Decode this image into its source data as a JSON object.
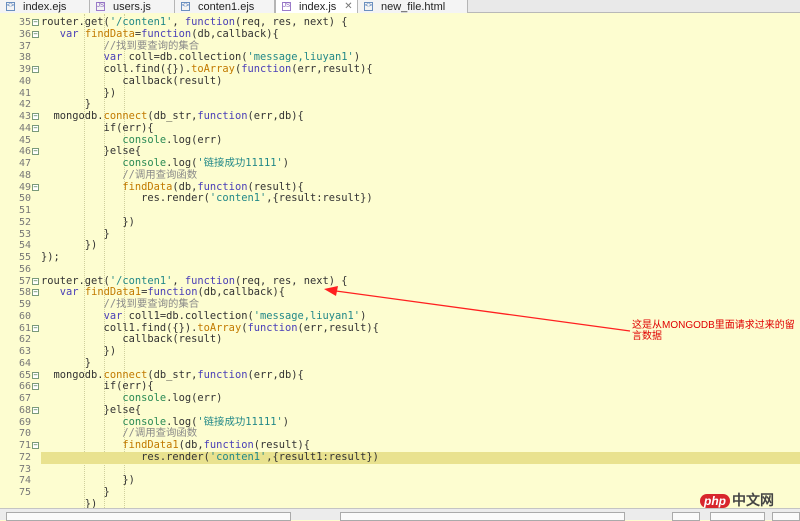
{
  "tabs": [
    {
      "label": "index.ejs",
      "type": "ejs"
    },
    {
      "label": "users.js",
      "type": "js"
    },
    {
      "label": "conten1.ejs",
      "type": "ejs"
    },
    {
      "label": "index.js",
      "type": "js",
      "active": true
    },
    {
      "label": "new_file.html",
      "type": "html"
    }
  ],
  "tab_icon_text": {
    "ejs": "<>",
    "html": "<>",
    "js": "JS"
  },
  "close_glyph": "✕",
  "highlighted_line": "72",
  "lines": [
    {
      "n": "35",
      "fold": true,
      "seg": [
        [
          "router.get(",
          ""
        ],
        [
          "'/conten1'",
          "str"
        ],
        [
          ", ",
          ""
        ],
        [
          "function",
          "kw"
        ],
        [
          "(req, res, next) {",
          ""
        ]
      ]
    },
    {
      "n": "36",
      "fold": true,
      "seg": [
        [
          "   ",
          ""
        ],
        [
          "var",
          "kw"
        ],
        [
          " ",
          ""
        ],
        [
          "findData",
          "fn"
        ],
        [
          "=",
          ""
        ],
        [
          "function",
          "kw"
        ],
        [
          "(db,callback){",
          ""
        ]
      ]
    },
    {
      "n": "37",
      "seg": [
        [
          "          ",
          ""
        ],
        [
          "//找到要查询的集合",
          "cm"
        ]
      ]
    },
    {
      "n": "38",
      "seg": [
        [
          "          ",
          ""
        ],
        [
          "var",
          "kw"
        ],
        [
          " coll=db.collection(",
          ""
        ],
        [
          "'message,liuyan1'",
          "str"
        ],
        [
          ")",
          ""
        ]
      ]
    },
    {
      "n": "39",
      "fold": true,
      "seg": [
        [
          "          coll.find({}).",
          ""
        ],
        [
          "toArray",
          "fn"
        ],
        [
          "(",
          ""
        ],
        [
          "function",
          "kw"
        ],
        [
          "(err,result){",
          ""
        ]
      ]
    },
    {
      "n": "40",
      "seg": [
        [
          "             callback(result)",
          ""
        ]
      ]
    },
    {
      "n": "41",
      "seg": [
        [
          "          })",
          ""
        ]
      ]
    },
    {
      "n": "42",
      "seg": [
        [
          "       }",
          ""
        ]
      ]
    },
    {
      "n": "43",
      "fold": true,
      "seg": [
        [
          "  mongodb.",
          ""
        ],
        [
          "connect",
          "fn"
        ],
        [
          "(db_str,",
          ""
        ],
        [
          "function",
          "kw"
        ],
        [
          "(err,db){",
          ""
        ]
      ]
    },
    {
      "n": "44",
      "fold": true,
      "seg": [
        [
          "          if(err){",
          ""
        ]
      ]
    },
    {
      "n": "45",
      "seg": [
        [
          "             ",
          ""
        ],
        [
          "console",
          "con"
        ],
        [
          ".log(err)",
          ""
        ]
      ]
    },
    {
      "n": "46",
      "fold": true,
      "seg": [
        [
          "          }else{",
          ""
        ]
      ]
    },
    {
      "n": "47",
      "seg": [
        [
          "             ",
          ""
        ],
        [
          "console",
          "con"
        ],
        [
          ".log(",
          ""
        ],
        [
          "'链接成功11111'",
          "str"
        ],
        [
          ")",
          ""
        ]
      ]
    },
    {
      "n": "48",
      "seg": [
        [
          "             ",
          ""
        ],
        [
          "//调用查询函数",
          "cm"
        ]
      ]
    },
    {
      "n": "49",
      "fold": true,
      "seg": [
        [
          "             ",
          ""
        ],
        [
          "findData",
          "fn"
        ],
        [
          "(db,",
          ""
        ],
        [
          "function",
          "kw"
        ],
        [
          "(result){",
          ""
        ]
      ]
    },
    {
      "n": "50",
      "seg": [
        [
          "                ",
          ""
        ],
        [
          "res.render(",
          ""
        ],
        [
          "'conten1'",
          "str"
        ],
        [
          ",{result:result})",
          ""
        ]
      ]
    },
    {
      "n": "51",
      "seg": []
    },
    {
      "n": "52",
      "seg": [
        [
          "             })",
          ""
        ]
      ]
    },
    {
      "n": "53",
      "seg": [
        [
          "          }",
          ""
        ]
      ]
    },
    {
      "n": "54",
      "seg": [
        [
          "       })",
          ""
        ]
      ]
    },
    {
      "n": "55",
      "seg": [
        [
          "});",
          ""
        ]
      ]
    },
    {
      "n": "56",
      "seg": []
    },
    {
      "n": "57",
      "fold": true,
      "seg": [
        [
          "router.get(",
          ""
        ],
        [
          "'/conten1'",
          "str"
        ],
        [
          ", ",
          ""
        ],
        [
          "function",
          "kw"
        ],
        [
          "(req, res, next) {",
          ""
        ]
      ]
    },
    {
      "n": "58",
      "fold": true,
      "seg": [
        [
          "   ",
          ""
        ],
        [
          "var",
          "kw"
        ],
        [
          " ",
          ""
        ],
        [
          "findData1",
          "fn"
        ],
        [
          "=",
          ""
        ],
        [
          "function",
          "kw"
        ],
        [
          "(db,callback){",
          ""
        ]
      ]
    },
    {
      "n": "59",
      "seg": [
        [
          "          ",
          ""
        ],
        [
          "//找到要查询的集合",
          "cm"
        ]
      ]
    },
    {
      "n": "60",
      "seg": [
        [
          "          ",
          ""
        ],
        [
          "var",
          "kw"
        ],
        [
          " coll1=db.collection(",
          ""
        ],
        [
          "'message,liuyan1'",
          "str"
        ],
        [
          ")",
          ""
        ]
      ]
    },
    {
      "n": "61",
      "fold": true,
      "seg": [
        [
          "          coll1.find({}).",
          ""
        ],
        [
          "toArray",
          "fn"
        ],
        [
          "(",
          ""
        ],
        [
          "function",
          "kw"
        ],
        [
          "(err,result){",
          ""
        ]
      ]
    },
    {
      "n": "62",
      "seg": [
        [
          "             callback(result)",
          ""
        ]
      ]
    },
    {
      "n": "63",
      "seg": [
        [
          "          })",
          ""
        ]
      ]
    },
    {
      "n": "64",
      "seg": [
        [
          "       }",
          ""
        ]
      ]
    },
    {
      "n": "65",
      "fold": true,
      "seg": [
        [
          "  mongodb.",
          ""
        ],
        [
          "connect",
          "fn"
        ],
        [
          "(db_str,",
          ""
        ],
        [
          "function",
          "kw"
        ],
        [
          "(err,db){",
          ""
        ]
      ]
    },
    {
      "n": "66",
      "fold": true,
      "seg": [
        [
          "          if(err){",
          ""
        ]
      ]
    },
    {
      "n": "67",
      "seg": [
        [
          "             ",
          ""
        ],
        [
          "console",
          "con"
        ],
        [
          ".log(err)",
          ""
        ]
      ]
    },
    {
      "n": "68",
      "fold": true,
      "seg": [
        [
          "          }else{",
          ""
        ]
      ]
    },
    {
      "n": "69",
      "seg": [
        [
          "             ",
          ""
        ],
        [
          "console",
          "con"
        ],
        [
          ".log(",
          ""
        ],
        [
          "'链接成功11111'",
          "str"
        ],
        [
          ")",
          ""
        ]
      ]
    },
    {
      "n": "70",
      "seg": [
        [
          "             ",
          ""
        ],
        [
          "//调用查询函数",
          "cm"
        ]
      ]
    },
    {
      "n": "71",
      "fold": true,
      "seg": [
        [
          "             ",
          ""
        ],
        [
          "findData1",
          "fn"
        ],
        [
          "(db,",
          ""
        ],
        [
          "function",
          "kw"
        ],
        [
          "(result){",
          ""
        ]
      ]
    },
    {
      "n": "72",
      "seg": [
        [
          "                ",
          ""
        ],
        [
          "res.render(",
          ""
        ],
        [
          "'conten1'",
          "str"
        ],
        [
          ",{result1:result})",
          ""
        ]
      ]
    },
    {
      "n": "73",
      "seg": []
    },
    {
      "n": "74",
      "seg": [
        [
          "             })",
          ""
        ]
      ]
    },
    {
      "n": "75",
      "seg": [
        [
          "          }",
          ""
        ]
      ]
    },
    {
      "n": "",
      "seg": [
        [
          "       })",
          ""
        ]
      ]
    }
  ],
  "annotation": {
    "text": "这是从MONGODB里面请求过来的留言数据",
    "color": "#e00000"
  },
  "watermark": {
    "badge": "php",
    "text": "中文网"
  }
}
